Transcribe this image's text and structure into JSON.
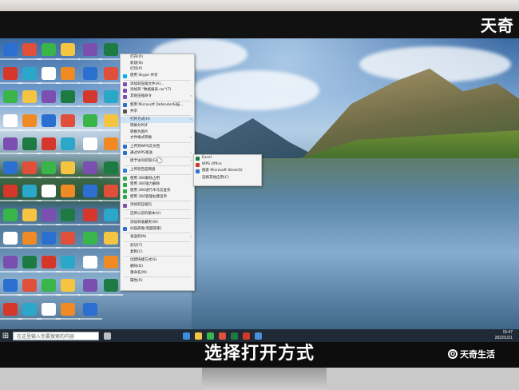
{
  "brand_text": "天奇",
  "caption": "选择打开方式",
  "watermark": "天奇生活",
  "taskbar": {
    "search_placeholder": "在这里输入你要搜索的内容",
    "time": "15:47",
    "date": "2022/1/21"
  },
  "context_menu": {
    "items": [
      {
        "label": "打开(O)",
        "icon": "",
        "arrow": false
      },
      {
        "label": "新建(N)",
        "icon": "",
        "arrow": false
      },
      {
        "label": "打印(P)",
        "icon": "",
        "arrow": false
      },
      {
        "label": "使用 Skype 共享",
        "icon": "skype-icon",
        "arrow": false
      },
      {
        "sep": true
      },
      {
        "label": "添加到压缩文件(A)...",
        "icon": "archive-icon",
        "arrow": false
      },
      {
        "label": "添加到 \"数据报表.rar\"(T)",
        "icon": "archive-icon",
        "arrow": false
      },
      {
        "label": "其他压缩命令",
        "icon": "archive-icon",
        "arrow": true
      },
      {
        "sep": true
      },
      {
        "label": "使用 Microsoft Defender扫描...",
        "icon": "defender-icon",
        "arrow": false
      },
      {
        "label": "共享",
        "icon": "share-icon",
        "arrow": false
      },
      {
        "sep": true
      },
      {
        "label": "打开方式(H)",
        "icon": "",
        "arrow": true,
        "selected": true
      },
      {
        "label": "转换为PDF",
        "icon": "",
        "arrow": false
      },
      {
        "label": "转换为图片",
        "icon": "",
        "arrow": false
      },
      {
        "label": "文件格式转换",
        "icon": "",
        "arrow": true
      },
      {
        "sep": true
      },
      {
        "label": "上传到WPS云文档",
        "icon": "wps-cloud-icon",
        "arrow": false
      },
      {
        "label": "通过WPS发送",
        "icon": "wps-send-icon",
        "arrow": true
      },
      {
        "sep": true
      },
      {
        "label": "授予访问权限(G)",
        "icon": "",
        "arrow": true
      },
      {
        "sep": true
      },
      {
        "label": "上传到百度网盘",
        "icon": "baidu-icon",
        "arrow": false
      },
      {
        "sep": true
      },
      {
        "label": "使用 360解除占用",
        "icon": "360-icon",
        "arrow": false
      },
      {
        "label": "使用 360强力删除",
        "icon": "360-icon",
        "arrow": false
      },
      {
        "label": "使用 360进行木马云查杀",
        "icon": "360-icon",
        "arrow": false
      },
      {
        "label": "使用 360管理右键菜单",
        "icon": "360-icon",
        "arrow": false
      },
      {
        "sep": true
      },
      {
        "label": "添加到压缩包",
        "icon": "archive-icon",
        "arrow": false
      },
      {
        "sep": true
      },
      {
        "label": "还原以前的版本(V)",
        "icon": "",
        "arrow": false
      },
      {
        "sep": true
      },
      {
        "label": "添加到收藏夹(W)",
        "icon": "",
        "arrow": false
      },
      {
        "label": "扫描病毒(电脑管家)",
        "icon": "tencent-icon",
        "arrow": false
      },
      {
        "sep": true
      },
      {
        "label": "发送到(N)",
        "icon": "",
        "arrow": true
      },
      {
        "sep": true
      },
      {
        "label": "剪切(T)",
        "icon": "",
        "arrow": false
      },
      {
        "label": "复制(C)",
        "icon": "",
        "arrow": false
      },
      {
        "sep": true
      },
      {
        "label": "创建快捷方式(S)",
        "icon": "",
        "arrow": false
      },
      {
        "label": "删除(D)",
        "icon": "",
        "arrow": false
      },
      {
        "label": "重命名(M)",
        "icon": "",
        "arrow": false
      },
      {
        "sep": true
      },
      {
        "label": "属性(R)",
        "icon": "",
        "arrow": false
      }
    ]
  },
  "submenu": {
    "items": [
      {
        "label": "Excel",
        "icon": "excel-icon"
      },
      {
        "label": "WPS Office",
        "icon": "wps-icon"
      },
      {
        "label": "搜索 Microsoft Store(S)",
        "icon": "store-icon"
      },
      {
        "label": "选择其他应用(C)",
        "icon": ""
      }
    ]
  },
  "colors": {
    "accent": "#cde4f7",
    "taskbar": "#1f2a36",
    "excel": "#1d7a43",
    "wps": "#d5372b",
    "store": "#2b6fd1",
    "archive": "#7a4fb0",
    "360": "#2ea84a"
  }
}
